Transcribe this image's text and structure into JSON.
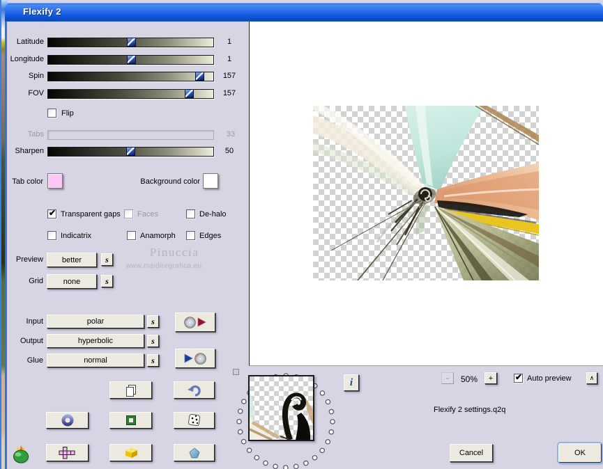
{
  "window": {
    "title": "Flexify 2"
  },
  "sliders": {
    "latitude": {
      "label": "Latitude",
      "value": "1"
    },
    "longitude": {
      "label": "Longitude",
      "value": "1"
    },
    "spin": {
      "label": "Spin",
      "value": "157"
    },
    "fov": {
      "label": "FOV",
      "value": "157"
    },
    "tabs": {
      "label": "Tabs",
      "value": "33"
    },
    "sharpen": {
      "label": "Sharpen",
      "value": "50"
    }
  },
  "checkboxes": {
    "flip": {
      "label": "Flip",
      "mark": ""
    },
    "transparent_gaps": {
      "label": "Transparent gaps",
      "mark": "✔"
    },
    "faces": {
      "label": "Faces",
      "mark": ""
    },
    "dehalo": {
      "label": "De-halo",
      "mark": ""
    },
    "indicatrix": {
      "label": "Indicatrix",
      "mark": ""
    },
    "anamorph": {
      "label": "Anamorph",
      "mark": ""
    },
    "edges": {
      "label": "Edges",
      "mark": ""
    },
    "auto_preview": {
      "label": "Auto preview",
      "mark": "✔"
    }
  },
  "colors": {
    "tab_color": {
      "label": "Tab color",
      "swatch": "#fcc7f8"
    },
    "background_color": {
      "label": "Background color",
      "swatch": "#ffffff"
    }
  },
  "dropdowns": {
    "preview": {
      "label": "Preview",
      "value": "better"
    },
    "grid": {
      "label": "Grid",
      "value": "none"
    },
    "input": {
      "label": "Input",
      "value": "polar"
    },
    "output": {
      "label": "Output",
      "value": "hyperbolic"
    },
    "glue": {
      "label": "Glue",
      "value": "normal"
    }
  },
  "s_button_label": "s",
  "info_button_label": "i",
  "watermark": {
    "line1": "Pinuccia",
    "line2": "www.maidiregrafica.eu"
  },
  "zoom": {
    "minus": "-",
    "level": "50%",
    "plus": "+",
    "expander": "∧"
  },
  "settings_file": "Flexify 2 settings.q2q",
  "actions": {
    "cancel": "Cancel",
    "ok": "OK"
  }
}
